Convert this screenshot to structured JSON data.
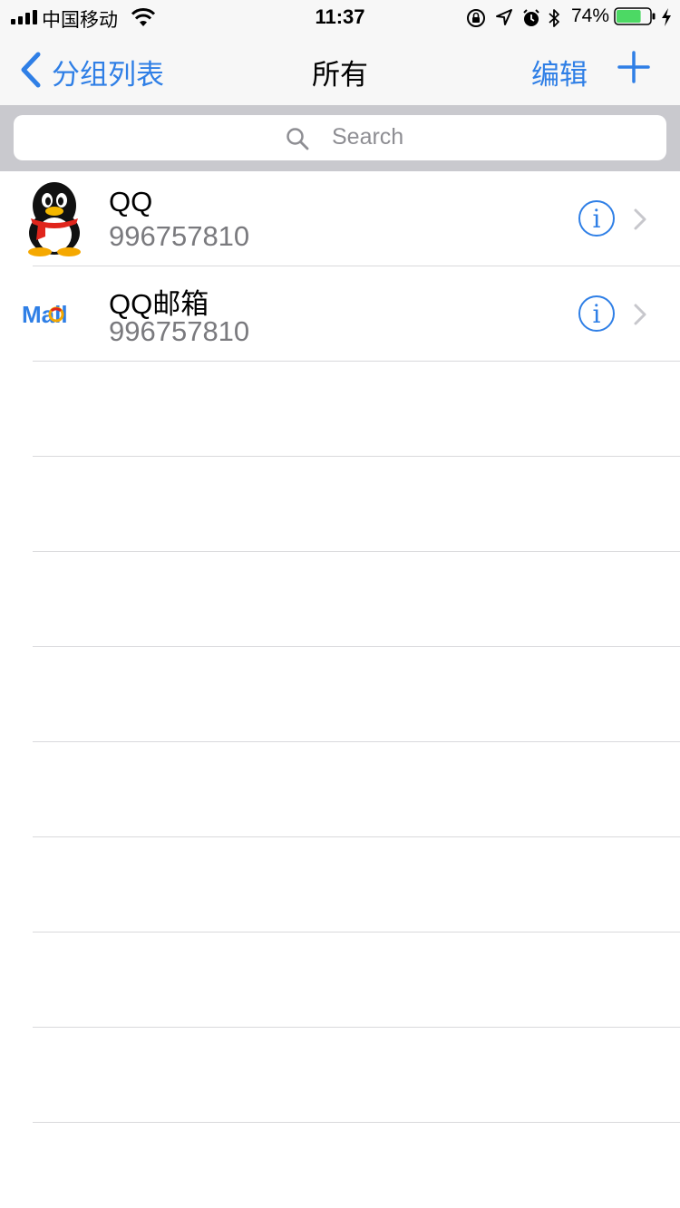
{
  "status_bar": {
    "carrier": "中国移动",
    "time": "11:37",
    "battery": "74%",
    "battery_level": 0.74,
    "battery_color": "#4cd964"
  },
  "nav": {
    "back_label": "分组列表",
    "title": "所有",
    "edit_label": "编辑",
    "add_icon": "plus-icon",
    "accent_color": "#2f7fe6"
  },
  "search": {
    "placeholder": "Search"
  },
  "accounts": [
    {
      "title": "QQ",
      "subtitle": "996757810",
      "icon": "qq-penguin-icon"
    },
    {
      "title": "QQ邮箱",
      "subtitle": "996757810",
      "icon": "qq-mail-logo-icon"
    }
  ],
  "mail_logo_text": "Mail"
}
